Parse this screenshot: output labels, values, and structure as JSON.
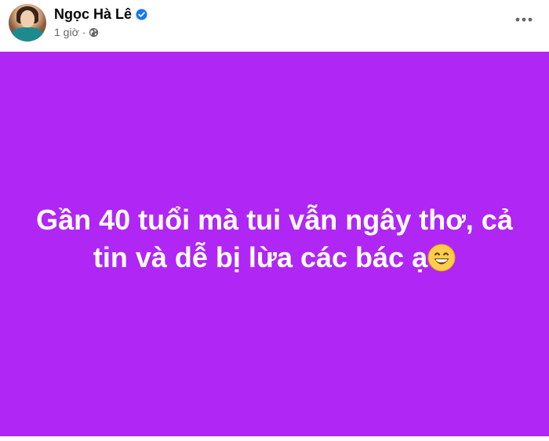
{
  "post": {
    "author_name": "Ngọc Hà Lê",
    "timestamp": "1 giờ",
    "separator": "·",
    "privacy_icon": "globe-icon",
    "verified_icon": "verified-badge-icon",
    "more_icon": "more-horizontal-icon",
    "text": "Gần 40 tuổi mà tui vẫn ngây thơ, cả tin và dễ bị lừa các bác ạ",
    "emoji_icon": "grinning-face-emoji",
    "background_color": "#b026f5"
  }
}
